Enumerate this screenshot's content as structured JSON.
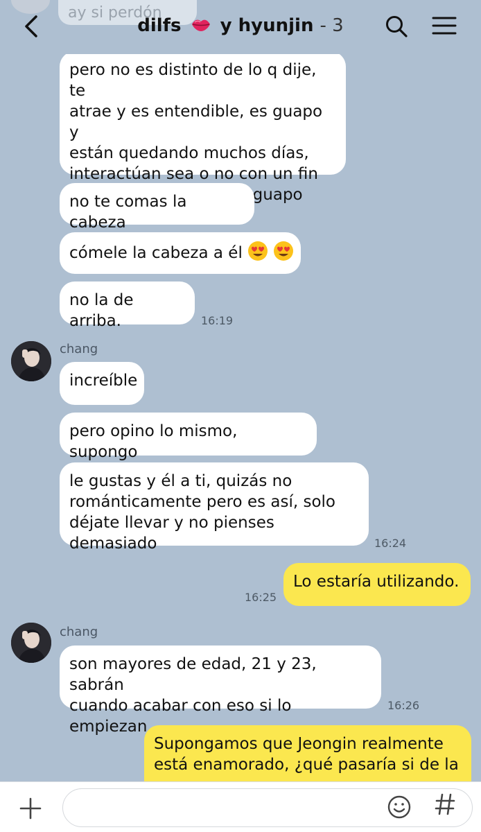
{
  "header": {
    "title_left": "dilfs",
    "title_right": "y hyunjin",
    "member_count": "- 3",
    "lips_icon": "kiss-mark-icon"
  },
  "previous_message": "ay si perdón",
  "messages": [
    {
      "side": "them",
      "text": "pero no es distinto de lo q dije, te\natrae y es entendible, es guapo y\nestán quedando muchos días,\ninteractúan sea o no con un fin\nestudiantil y repito, es guapo"
    },
    {
      "side": "them",
      "text": "no te comas la cabeza"
    },
    {
      "side": "them",
      "text": "cómele la cabeza a él",
      "emoji": "heart-eyes-icon"
    },
    {
      "side": "them",
      "text": "no la de arriba.",
      "time": "16:19"
    },
    {
      "side": "them",
      "sender": "chang",
      "text": "increíble"
    },
    {
      "side": "them",
      "text": "pero opino lo mismo, supongo"
    },
    {
      "side": "them",
      "text": "le gustas y él a ti, quizás no\nrománticamente pero es así, solo\ndéjate llevar y no pienses demasiado",
      "time": "16:24"
    },
    {
      "side": "me",
      "text": "Lo estaría utilizando.",
      "time": "16:25"
    },
    {
      "side": "them",
      "sender": "chang",
      "text": "son mayores de edad, 21 y 23, sabrán\ncuando acabar con eso si lo empiezan",
      "time": "16:26"
    },
    {
      "side": "me",
      "text": "Supongamos que Jeongin realmente\nestá enamorado, ¿qué pasaría si de la"
    }
  ],
  "input": {
    "placeholder": "",
    "value": ""
  },
  "colors": {
    "background": "#aebfd1",
    "my_bubble": "#fbe74f",
    "their_bubble": "#ffffff"
  }
}
